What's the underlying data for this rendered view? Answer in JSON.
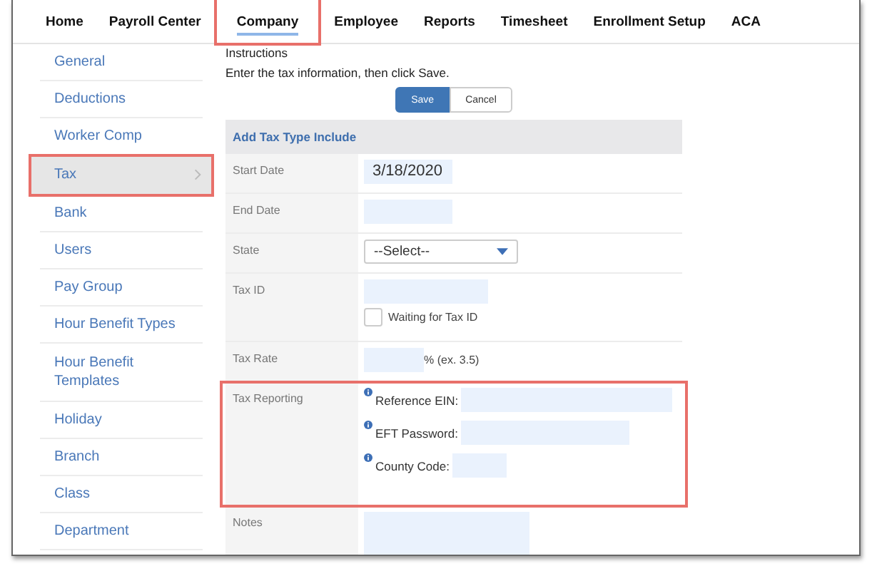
{
  "nav": [
    {
      "label": "Home",
      "selected": false,
      "highlighted": false
    },
    {
      "label": "Payroll Center",
      "selected": false,
      "highlighted": false
    },
    {
      "label": "Company",
      "selected": true,
      "highlighted": true
    },
    {
      "label": "Employee",
      "selected": false,
      "highlighted": false
    },
    {
      "label": "Reports",
      "selected": false,
      "highlighted": false
    },
    {
      "label": "Timesheet",
      "selected": false,
      "highlighted": false
    },
    {
      "label": "Enrollment Setup",
      "selected": false,
      "highlighted": false
    },
    {
      "label": "ACA",
      "selected": false,
      "highlighted": false
    }
  ],
  "sidebar": {
    "items": [
      {
        "label": "General",
        "selected": false,
        "highlighted": false
      },
      {
        "label": "Deductions",
        "selected": false,
        "highlighted": false
      },
      {
        "label": "Worker Comp",
        "selected": false,
        "highlighted": false
      },
      {
        "label": "Tax",
        "selected": true,
        "highlighted": true
      },
      {
        "label": "Bank",
        "selected": false,
        "highlighted": false
      },
      {
        "label": "Users",
        "selected": false,
        "highlighted": false
      },
      {
        "label": "Pay Group",
        "selected": false,
        "highlighted": false
      },
      {
        "label": "Hour Benefit Types",
        "selected": false,
        "highlighted": false
      },
      {
        "label": "Hour Benefit Templates",
        "selected": false,
        "highlighted": false
      },
      {
        "label": "Holiday",
        "selected": false,
        "highlighted": false
      },
      {
        "label": "Branch",
        "selected": false,
        "highlighted": false
      },
      {
        "label": "Class",
        "selected": false,
        "highlighted": false
      },
      {
        "label": "Department",
        "selected": false,
        "highlighted": false
      }
    ]
  },
  "instructions": {
    "title": "Instructions",
    "text": "Enter the tax information, then click Save."
  },
  "buttons": {
    "save": "Save",
    "cancel": "Cancel"
  },
  "form": {
    "title": "Add Tax Type Include",
    "rows": [
      {
        "kind": "text",
        "label": "Start Date",
        "value": "3/18/2020",
        "highlighted": false
      },
      {
        "kind": "text",
        "label": "End Date",
        "highlighted": false
      },
      {
        "kind": "select",
        "label": "State",
        "value": "--Select--",
        "highlighted": false
      },
      {
        "kind": "checkbox",
        "label": "Tax ID",
        "check_label": "Waiting for Tax ID",
        "checked": false,
        "highlighted": false
      },
      {
        "kind": "rate",
        "label": "Tax Rate",
        "suffix": "% (ex. 3.5)",
        "highlighted": false
      },
      {
        "kind": "reporting",
        "label": "Tax Reporting",
        "highlighted": true,
        "fields": [
          {
            "label": "Reference EIN:"
          },
          {
            "label": "EFT Password:"
          },
          {
            "label": "County Code:"
          }
        ]
      },
      {
        "kind": "textarea",
        "label": "Notes",
        "highlighted": false
      }
    ]
  }
}
